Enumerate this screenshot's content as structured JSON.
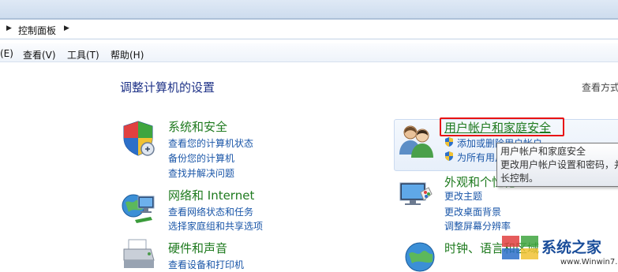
{
  "address": {
    "crumb": "控制面板"
  },
  "menu": [
    "(E)",
    "查看(V)",
    "工具(T)",
    "帮助(H)"
  ],
  "page_title": "调整计算机的设置",
  "view_by": "查看方式",
  "categories": {
    "system": {
      "title": "系统和安全",
      "links": [
        "查看您的计算机状态",
        "备份您的计算机",
        "查找并解决问题"
      ]
    },
    "network": {
      "title": "网络和 Internet",
      "links": [
        "查看网络状态和任务",
        "选择家庭组和共享选项"
      ]
    },
    "hardware": {
      "title": "硬件和声音",
      "links": [
        "查看设备和打印机"
      ]
    },
    "user": {
      "title": "用户帐户和家庭安全",
      "links": [
        "添加或删除用户帐户",
        "为所有用户设置家长控制"
      ]
    },
    "appearance": {
      "title": "外观和个性化",
      "links": [
        "更改主题",
        "更改桌面背景",
        "调整屏幕分辨率"
      ]
    },
    "clock": {
      "title": "时钟、语言和区域"
    }
  },
  "tooltip": {
    "line1": "用户帐户和家庭安全",
    "line2": "更改用户帐户设置和密码，并",
    "line3": "长控制。"
  },
  "watermark": {
    "site": "系统之家",
    "url": "www.Winwin7.com"
  },
  "colors": {
    "link": "#1a56a8",
    "category": "#1e7a1e",
    "title": "#1e3287",
    "highlight": "#e81313"
  }
}
